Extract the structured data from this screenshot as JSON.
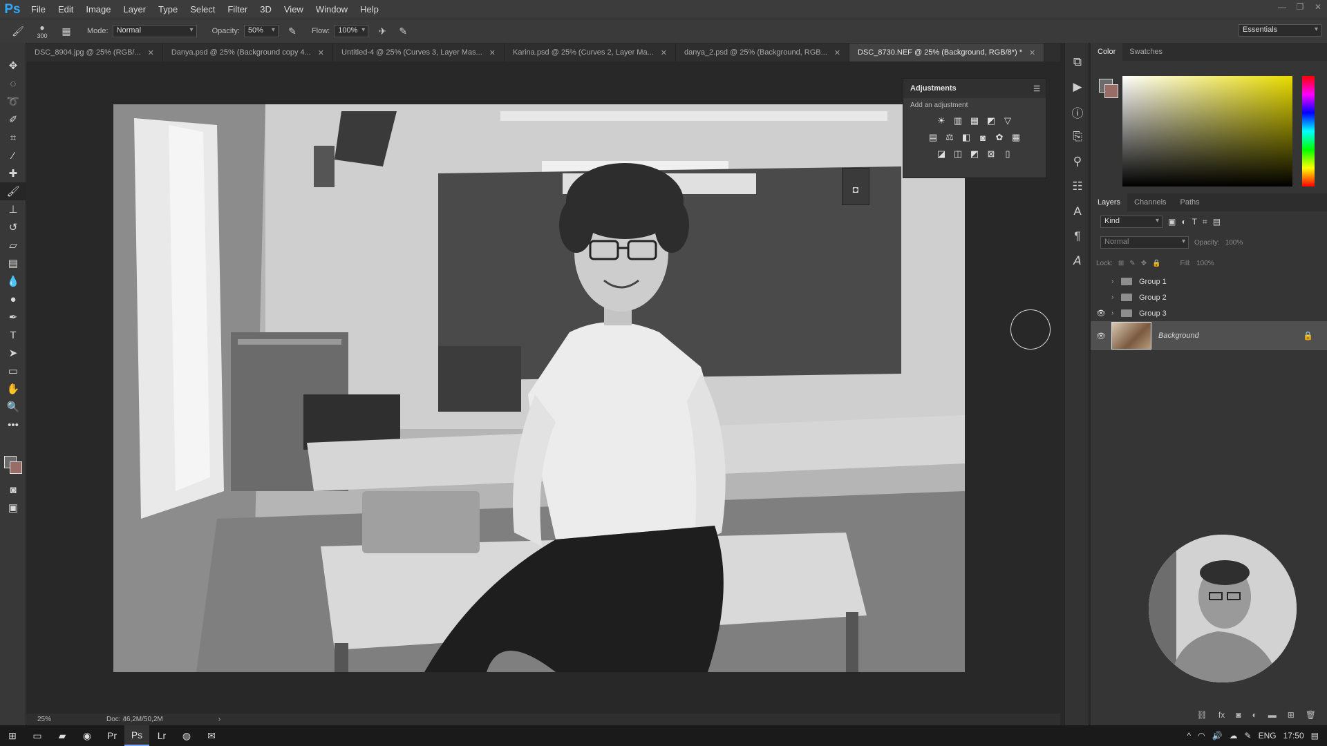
{
  "app": {
    "logo": "Ps"
  },
  "menu": [
    "File",
    "Edit",
    "Image",
    "Layer",
    "Type",
    "Select",
    "Filter",
    "3D",
    "View",
    "Window",
    "Help"
  ],
  "options_bar": {
    "brush_size": "300",
    "mode_label": "Mode:",
    "mode_value": "Normal",
    "opacity_label": "Opacity:",
    "opacity_value": "50%",
    "flow_label": "Flow:",
    "flow_value": "100%",
    "workspace": "Essentials"
  },
  "tabs": [
    {
      "label": "DSC_8904.jpg @ 25% (RGB/...",
      "active": false
    },
    {
      "label": "Danya.psd @ 25% (Background copy 4...",
      "active": false
    },
    {
      "label": "Untitled-4 @ 25% (Curves 3, Layer Mas...",
      "active": false
    },
    {
      "label": "Karina.psd @ 25% (Curves 2, Layer Ma...",
      "active": false
    },
    {
      "label": "danya_2.psd @ 25% (Background, RGB...",
      "active": false
    },
    {
      "label": "DSC_8730.NEF @ 25% (Background, RGB/8*) *",
      "active": true
    }
  ],
  "adjustments": {
    "title": "Adjustments",
    "subtitle": "Add an adjustment"
  },
  "color_panel": {
    "tabs": [
      "Color",
      "Swatches"
    ],
    "foreground": "#6b6b6b",
    "background": "#9a6c68"
  },
  "layers_panel": {
    "tabs": [
      "Layers",
      "Channels",
      "Paths"
    ],
    "kind_label": "Kind",
    "blend_mode": "Normal",
    "opacity_label": "Opacity:",
    "opacity_value": "100%",
    "lock_label": "Lock:",
    "fill_label": "Fill:",
    "fill_value": "100%",
    "layers": [
      {
        "name": "Group 1",
        "visible": false
      },
      {
        "name": "Group 2",
        "visible": false
      },
      {
        "name": "Group 3",
        "visible": true
      },
      {
        "name": "Background",
        "visible": true
      }
    ]
  },
  "status": {
    "zoom": "25%",
    "doc": "Doc: 46,2M/50,2M"
  },
  "taskbar": {
    "lang": "ENG",
    "time": "17:50"
  }
}
